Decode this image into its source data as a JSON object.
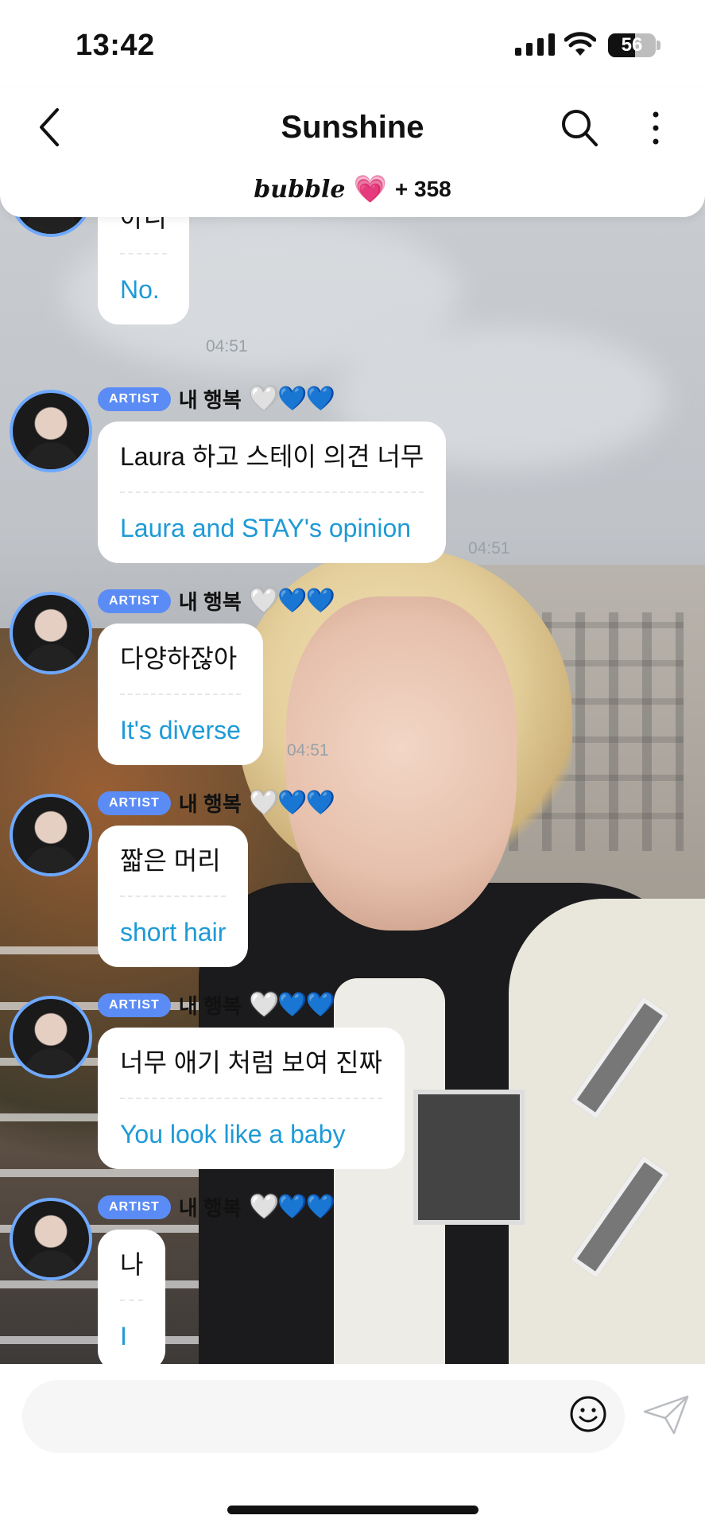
{
  "status_bar": {
    "time": "13:42",
    "battery": "56",
    "battery_level_percent": 56
  },
  "header": {
    "title": "Sunshine",
    "brand": "bubble",
    "count": "+ 358"
  },
  "labels": {
    "artist_badge": "ARTIST",
    "sender_name": "내 행복"
  },
  "messages": [
    {
      "original": "아니",
      "translation": "No.",
      "time": "04:51",
      "show_meta": false
    },
    {
      "original": "Laura 하고 스테이 의견 너무",
      "translation": "Laura and STAY's opinion",
      "time": "04:51",
      "show_meta": true
    },
    {
      "original": "다양하잖아",
      "translation": "It's diverse",
      "time": "04:51",
      "show_meta": true
    },
    {
      "original": "짧은 머리",
      "translation": "short hair",
      "time": "",
      "show_meta": true
    },
    {
      "original": "너무 애기 처럼 보여 진짜",
      "translation": "You look like a baby",
      "time": "",
      "show_meta": true
    },
    {
      "original": "나",
      "translation": "I",
      "time": "",
      "show_meta": true
    }
  ],
  "icons": {
    "back": "chevron-left-icon",
    "search": "search-icon",
    "more": "more-vertical-icon",
    "heart": "pink-heart-icon",
    "emoji": "smiley-icon",
    "send": "paper-plane-icon"
  },
  "colors": {
    "translation_text": "#1e9ad6",
    "artist_badge": "#5b8cf5",
    "avatar_ring": "#6ea9ff",
    "bubble_heart": "#f07ab2"
  }
}
